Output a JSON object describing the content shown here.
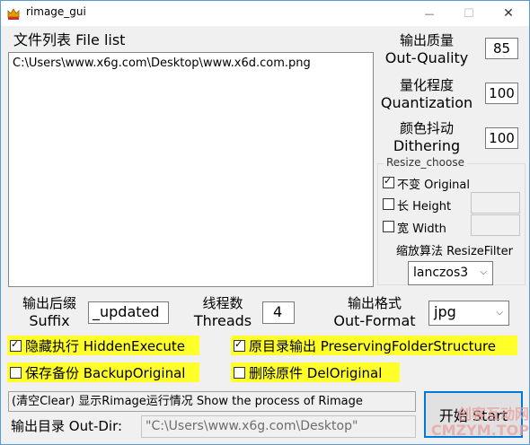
{
  "window": {
    "title": "rimage_gui",
    "minimize_glyph": "—",
    "maximize_glyph": "☐",
    "close_glyph": "✕"
  },
  "file_list": {
    "label": "文件列表 File list",
    "items": [
      "C:\\Users\\www.x6g.com\\Desktop\\www.x6d.com.png"
    ]
  },
  "quality": {
    "label_cn": "输出质量",
    "label_en": "Out-Quality",
    "value": "85"
  },
  "quantization": {
    "label_cn": "量化程度",
    "label_en": "Quantization",
    "value": "100"
  },
  "dithering": {
    "label_cn": "颜色抖动",
    "label_en": "Dithering",
    "value": "100"
  },
  "resize": {
    "group_title": "Resize_choose",
    "original": {
      "label": "不变 Original",
      "checked": true,
      "mark": "✓"
    },
    "height": {
      "label": "长 Height",
      "checked": false,
      "value": ""
    },
    "width": {
      "label": "宽 Width",
      "checked": false,
      "value": ""
    },
    "filter_label": "缩放算法 ResizeFilter",
    "filter_value": "lanczos3"
  },
  "suffix": {
    "label_cn": "输出后缀",
    "label_en": "Suffix",
    "value": "_updated"
  },
  "threads": {
    "label_cn": "线程数",
    "label_en": "Threads",
    "value": "4"
  },
  "format": {
    "label_cn": "输出格式",
    "label_en": "Out-Format",
    "value": "jpg"
  },
  "options": {
    "hidden_execute": {
      "label": "隐藏执行 HiddenExecute",
      "checked": true,
      "mark": "✓"
    },
    "preserve_structure": {
      "label": "原目录输出 PreservingFolderStructure",
      "checked": true,
      "mark": "✓"
    },
    "backup_original": {
      "label": "保存备份 BackupOriginal",
      "checked": false
    },
    "del_original": {
      "label": "删除原件 DelOriginal",
      "checked": false
    }
  },
  "status_text": "(清空Clear) 显示Rimage运行情况 Show the process of Rimage",
  "out_dir": {
    "label": "输出目录 Out-Dir:",
    "value": "\"C:\\Users\\www.x6g.com\\Desktop\""
  },
  "start_button": "开始 Start",
  "watermark": {
    "line1": "创客互动网",
    "line2": "CMZYM.TOP"
  },
  "colors": {
    "highlight": "#ffff2a",
    "accent": "#0078d7"
  }
}
